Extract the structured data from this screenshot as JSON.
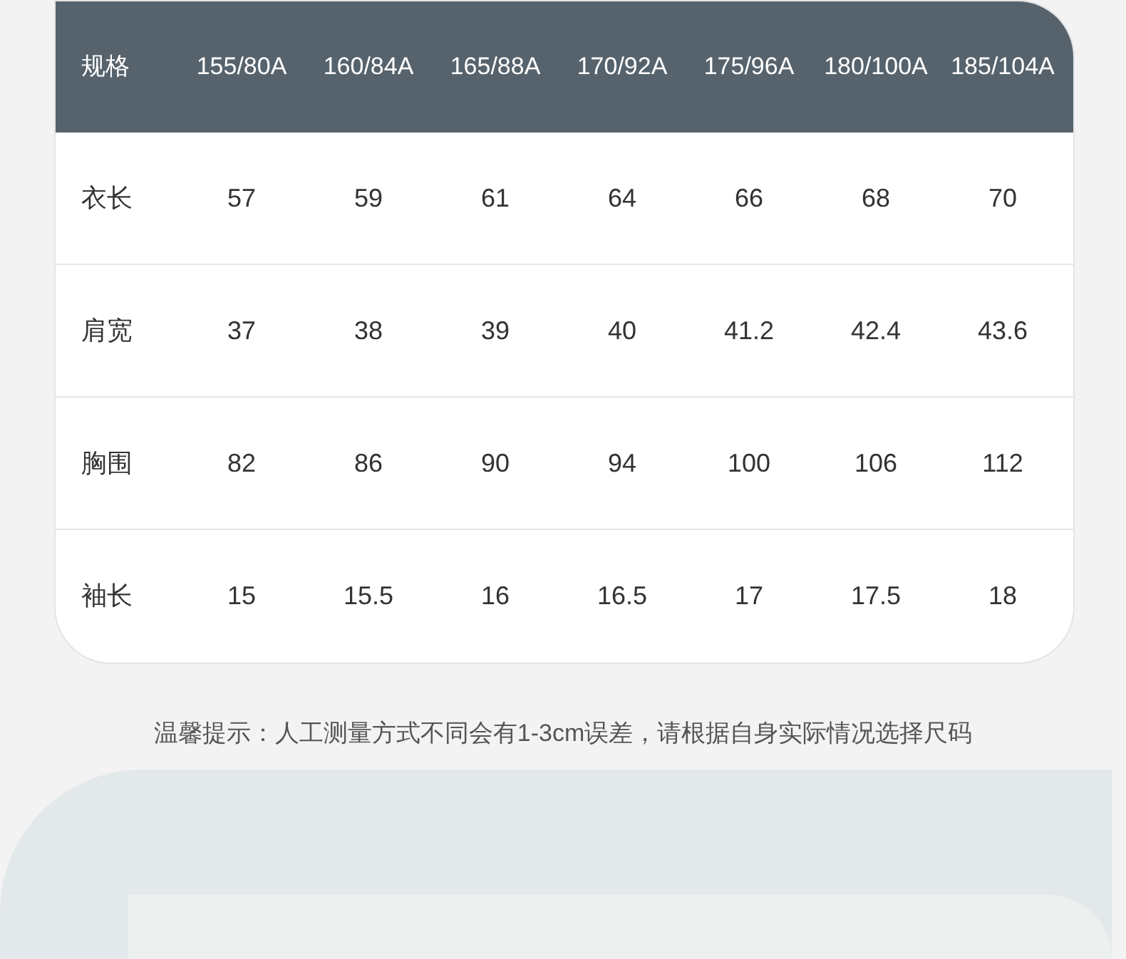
{
  "table": {
    "columns": [
      "规格",
      "155/80A",
      "160/84A",
      "165/88A",
      "170/92A",
      "175/96A",
      "180/100A",
      "185/104A"
    ],
    "rows": [
      {
        "label": "衣长",
        "values": [
          "57",
          "59",
          "61",
          "64",
          "66",
          "68",
          "70"
        ]
      },
      {
        "label": "肩宽",
        "values": [
          "37",
          "38",
          "39",
          "40",
          "41.2",
          "42.4",
          "43.6"
        ]
      },
      {
        "label": "胸围",
        "values": [
          "82",
          "86",
          "90",
          "94",
          "100",
          "106",
          "112"
        ]
      },
      {
        "label": "袖长",
        "values": [
          "15",
          "15.5",
          "16",
          "16.5",
          "17",
          "17.5",
          "18"
        ]
      }
    ]
  },
  "note": "温馨提示：人工测量方式不同会有1-3cm误差，请根据自身实际情况选择尺码"
}
